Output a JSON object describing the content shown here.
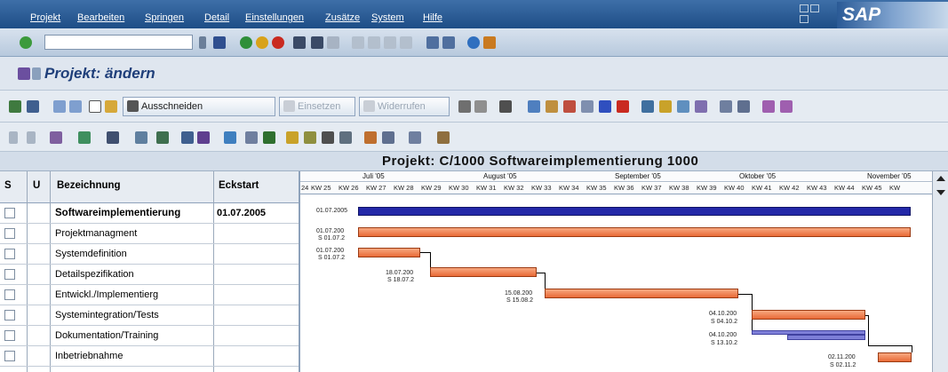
{
  "menu": [
    "Projekt",
    "Bearbeiten",
    "Springen",
    "Detail",
    "Einstellungen",
    "Zusätze",
    "System",
    "Hilfe"
  ],
  "brand": "SAP",
  "title": "Projekt: ändern",
  "toolbar": {
    "cut": "Ausschneiden",
    "paste": "Einsetzen",
    "undo": "Widerrufen"
  },
  "gantt_title": "Projekt: C/1000    Softwareimplementierung 1000",
  "columns": {
    "s": "S",
    "u": "U",
    "name": "Bezeichnung",
    "start": "Eckstart"
  },
  "rows": [
    {
      "name": "Softwareimplementierung",
      "start": "01.07.2005",
      "bold": true
    },
    {
      "name": "Projektmanagment",
      "start": ""
    },
    {
      "name": "Systemdefinition",
      "start": ""
    },
    {
      "name": "Detailspezifikation",
      "start": ""
    },
    {
      "name": "Entwickl./Implementierg",
      "start": ""
    },
    {
      "name": "Systemintegration/Tests",
      "start": ""
    },
    {
      "name": "Dokumentation/Training",
      "start": ""
    },
    {
      "name": "Inbetriebnahme",
      "start": ""
    }
  ],
  "timeline": {
    "months": [
      "Juli '05",
      "August '05",
      "September '05",
      "Oktober '05",
      "November '05"
    ],
    "weeks": [
      "24",
      "KW 25",
      "KW 26",
      "KW 27",
      "KW 28",
      "KW 29",
      "KW 30",
      "KW 31",
      "KW 32",
      "KW 33",
      "KW 34",
      "KW 35",
      "KW 36",
      "KW 37",
      "KW 38",
      "KW 39",
      "KW 40",
      "KW 41",
      "KW 42",
      "KW 43",
      "KW 44",
      "KW 45",
      "KW"
    ]
  },
  "bar_labels": {
    "sum": "01.07.2005",
    "pm_a": "01.07.200",
    "pm_b": "S 01.07.2",
    "sd_a": "01.07.200",
    "sd_b": "S 01.07.2",
    "ds_a": "18.07.200",
    "ds_b": "S 18.07.2",
    "ei_a": "15.08.200",
    "ei_b": "S 15.08.2",
    "st_a": "04.10.200",
    "st_b": "S 04.10.2",
    "dt_a": "04.10.200",
    "dt_b": "S 13.10.2",
    "ib_a": "02.11.200",
    "ib_b": "S 02.11.2"
  },
  "colors": {
    "bar": "#ef7c4a",
    "summary": "#2328a8",
    "secondary": "#7e7fd8",
    "header": "#1d4d86"
  }
}
